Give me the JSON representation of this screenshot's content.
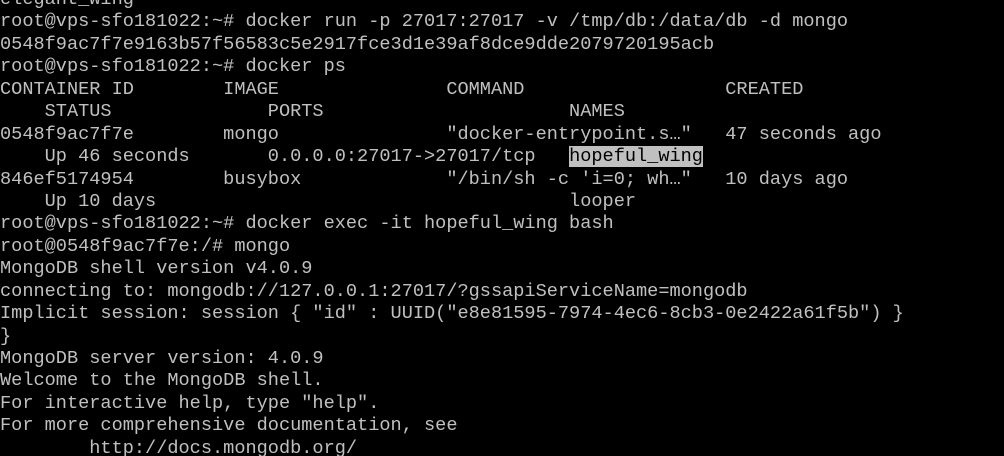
{
  "terminal": {
    "lines": [
      "elegant_wing",
      "root@vps-sfo181022:~# docker run -p 27017:27017 -v /tmp/db:/data/db -d mongo",
      "0548f9ac7f7e9163b57f56583c5e2917fce3d1e39af8dce9dde2079720195acb",
      "root@vps-sfo181022:~# docker ps",
      "CONTAINER ID        IMAGE               COMMAND                  CREATED",
      "    STATUS              PORTS                      NAMES",
      "0548f9ac7f7e        mongo               \"docker-entrypoint.s…\"   47 seconds ago",
      "    Up 46 seconds       0.0.0.0:27017->27017/tcp   ",
      "846ef5174954        busybox             \"/bin/sh -c 'i=0; wh…\"   10 days ago",
      "    Up 10 days                                     looper",
      "root@vps-sfo181022:~# docker exec -it hopeful_wing bash",
      "root@0548f9ac7f7e:/# mongo",
      "MongoDB shell version v4.0.9",
      "connecting to: mongodb://127.0.0.1:27017/?gssapiServiceName=mongodb",
      "Implicit session: session { \"id\" : UUID(\"e8e81595-7974-4ec6-8cb3-0e2422a61f5b\") }",
      "}",
      "MongoDB server version: 4.0.9",
      "Welcome to the MongoDB shell.",
      "For interactive help, type \"help\".",
      "For more comprehensive documentation, see",
      "        http://docs.mongodb.org/"
    ],
    "selected_name": "hopeful_wing"
  },
  "colors": {
    "background": "#000000",
    "foreground": "#c0c0c0",
    "selection_bg": "#c0c0c0",
    "selection_fg": "#000000"
  }
}
